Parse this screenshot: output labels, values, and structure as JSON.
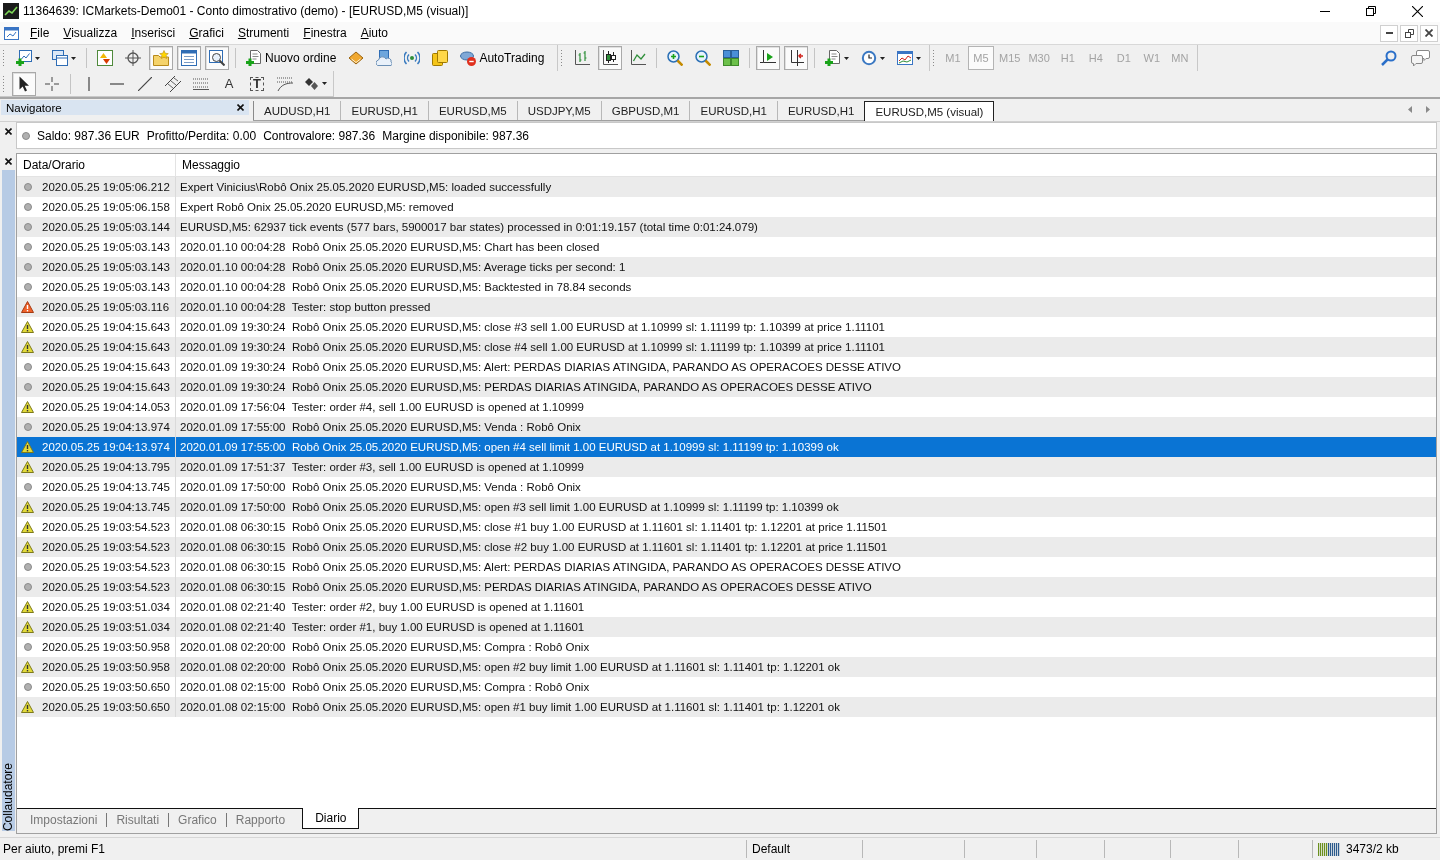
{
  "window": {
    "title": "11364639: ICMarkets-Demo01 - Conto dimostrativo (demo) - [EURUSD,M5 (visual)]"
  },
  "menu": [
    "File",
    "Visualizza",
    "Inserisci",
    "Grafici",
    "Strumenti",
    "Finestra",
    "Aiuto"
  ],
  "toolbar": [
    {
      "on": false,
      "dropdown": true
    },
    {
      "on": false,
      "dropdown": true
    },
    {
      "on": false,
      "dropdown": false
    },
    {
      "on": false,
      "dropdown": false
    },
    {
      "on": true,
      "dropdown": false
    },
    {
      "on": true,
      "dropdown": false
    },
    {
      "on": true,
      "dropdown": false
    },
    {
      "on": false,
      "dropdown": false,
      "label": "Nuovo ordine"
    },
    {
      "on": false,
      "dropdown": false
    },
    {
      "on": false,
      "dropdown": false
    },
    {
      "on": false,
      "dropdown": false
    },
    {
      "on": false,
      "dropdown": false
    },
    {
      "on": false,
      "dropdown": false,
      "label": "AutoTrading"
    },
    {
      "on": false,
      "dropdown": false
    },
    {
      "on": true,
      "dropdown": false
    },
    {
      "on": false,
      "dropdown": false
    },
    {
      "on": false,
      "dropdown": false
    },
    {
      "on": false,
      "dropdown": false
    },
    {
      "on": false,
      "dropdown": false
    },
    {
      "on": true,
      "dropdown": false
    },
    {
      "on": true,
      "dropdown": false
    },
    {
      "on": false,
      "dropdown": true
    },
    {
      "on": false,
      "dropdown": true
    },
    {
      "on": false,
      "dropdown": true
    }
  ],
  "timeframes": [
    {
      "label": "M1",
      "selected": false,
      "disabled": true
    },
    {
      "label": "M5",
      "selected": true,
      "disabled": true
    },
    {
      "label": "M15",
      "selected": false,
      "disabled": true
    },
    {
      "label": "M30",
      "selected": false,
      "disabled": true
    },
    {
      "label": "H1",
      "selected": false,
      "disabled": true
    },
    {
      "label": "H4",
      "selected": false,
      "disabled": true
    },
    {
      "label": "D1",
      "selected": false,
      "disabled": true
    },
    {
      "label": "W1",
      "selected": false,
      "disabled": true
    },
    {
      "label": "MN",
      "selected": false,
      "disabled": true
    }
  ],
  "drawing_tools": [
    {
      "on": true,
      "dropdown": false
    },
    {
      "on": false,
      "dropdown": false
    },
    {
      "on": false,
      "dropdown": false
    },
    {
      "on": false,
      "dropdown": false
    },
    {
      "on": false,
      "dropdown": false
    },
    {
      "on": false,
      "dropdown": false
    },
    {
      "on": false,
      "dropdown": false
    },
    {
      "on": false,
      "dropdown": false,
      "glyph": "A"
    },
    {
      "on": false,
      "dropdown": false,
      "glyph": "T"
    },
    {
      "on": false,
      "dropdown": false
    },
    {
      "on": false,
      "dropdown": true
    }
  ],
  "navigator": {
    "title": "Navigatore"
  },
  "chart_tabs": [
    {
      "label": "AUDUSD,H1",
      "selected": false
    },
    {
      "label": "EURUSD,H1",
      "selected": false
    },
    {
      "label": "EURUSD,M5",
      "selected": false
    },
    {
      "label": "USDJPY,M5",
      "selected": false
    },
    {
      "label": "GBPUSD,M1",
      "selected": false
    },
    {
      "label": "EURUSD,H1",
      "selected": false
    },
    {
      "label": "EURUSD,H1",
      "selected": false
    },
    {
      "label": "EURUSD,M5 (visual)",
      "selected": true
    }
  ],
  "account_bar": {
    "items": [
      "Saldo: 987.36 EUR",
      "Profitto/Perdita: 0.00",
      "Controvalore: 987.36",
      "Margine disponibile: 987.36"
    ]
  },
  "tester": {
    "title": "Collaudatore",
    "columns": [
      "Data/Orario",
      "Messaggio"
    ],
    "rows": [
      {
        "kind": "info",
        "selected": false,
        "time": "2020.05.25 19:05:06.212",
        "message": "Expert Vinicius\\Robô Onix 25.05.2020 EURUSD,M5: loaded successfully"
      },
      {
        "kind": "info",
        "selected": false,
        "time": "2020.05.25 19:05:06.158",
        "message": "Expert Robô Onix 25.05.2020 EURUSD,M5: removed"
      },
      {
        "kind": "info",
        "selected": false,
        "time": "2020.05.25 19:05:03.144",
        "message": "EURUSD,M5: 62937 tick events (577 bars, 5900017 bar states) processed in 0:01:19.157 (total time 0:01:24.079)"
      },
      {
        "kind": "info",
        "selected": false,
        "time": "2020.05.25 19:05:03.143",
        "message": "2020.01.10 00:04:28  Robô Onix 25.05.2020 EURUSD,M5: Chart has been closed"
      },
      {
        "kind": "info",
        "selected": false,
        "time": "2020.05.25 19:05:03.143",
        "message": "2020.01.10 00:04:28  Robô Onix 25.05.2020 EURUSD,M5: Average ticks per second: 1"
      },
      {
        "kind": "info",
        "selected": false,
        "time": "2020.05.25 19:05:03.143",
        "message": "2020.01.10 00:04:28  Robô Onix 25.05.2020 EURUSD,M5: Backtested in 78.84 seconds"
      },
      {
        "kind": "error",
        "selected": false,
        "time": "2020.05.25 19:05:03.116",
        "message": "2020.01.10 00:04:28  Tester: stop button pressed"
      },
      {
        "kind": "warning",
        "selected": false,
        "time": "2020.05.25 19:04:15.643",
        "message": "2020.01.09 19:30:24  Robô Onix 25.05.2020 EURUSD,M5: close #3 sell 1.00 EURUSD at 1.10999 sl: 1.11199 tp: 1.10399 at price 1.11101"
      },
      {
        "kind": "warning",
        "selected": false,
        "time": "2020.05.25 19:04:15.643",
        "message": "2020.01.09 19:30:24  Robô Onix 25.05.2020 EURUSD,M5: close #4 sell 1.00 EURUSD at 1.10999 sl: 1.11199 tp: 1.10399 at price 1.11101"
      },
      {
        "kind": "info",
        "selected": false,
        "time": "2020.05.25 19:04:15.643",
        "message": "2020.01.09 19:30:24  Robô Onix 25.05.2020 EURUSD,M5: Alert: PERDAS DIARIAS ATINGIDA, PARANDO AS OPERACOES DESSE ATIVO"
      },
      {
        "kind": "info",
        "selected": false,
        "time": "2020.05.25 19:04:15.643",
        "message": "2020.01.09 19:30:24  Robô Onix 25.05.2020 EURUSD,M5: PERDAS DIARIAS ATINGIDA, PARANDO AS OPERACOES DESSE ATIVO"
      },
      {
        "kind": "warning",
        "selected": false,
        "time": "2020.05.25 19:04:14.053",
        "message": "2020.01.09 17:56:04  Tester: order #4, sell 1.00 EURUSD is opened at 1.10999"
      },
      {
        "kind": "info",
        "selected": false,
        "time": "2020.05.25 19:04:13.974",
        "message": "2020.01.09 17:55:00  Robô Onix 25.05.2020 EURUSD,M5: Venda : Robô Onix"
      },
      {
        "kind": "warning",
        "selected": true,
        "time": "2020.05.25 19:04:13.974",
        "message": "2020.01.09 17:55:00  Robô Onix 25.05.2020 EURUSD,M5: open #4 sell limit 1.00 EURUSD at 1.10999 sl: 1.11199 tp: 1.10399 ok"
      },
      {
        "kind": "warning",
        "selected": false,
        "time": "2020.05.25 19:04:13.795",
        "message": "2020.01.09 17:51:37  Tester: order #3, sell 1.00 EURUSD is opened at 1.10999"
      },
      {
        "kind": "info",
        "selected": false,
        "time": "2020.05.25 19:04:13.745",
        "message": "2020.01.09 17:50:00  Robô Onix 25.05.2020 EURUSD,M5: Venda : Robô Onix"
      },
      {
        "kind": "warning",
        "selected": false,
        "time": "2020.05.25 19:04:13.745",
        "message": "2020.01.09 17:50:00  Robô Onix 25.05.2020 EURUSD,M5: open #3 sell limit 1.00 EURUSD at 1.10999 sl: 1.11199 tp: 1.10399 ok"
      },
      {
        "kind": "warning",
        "selected": false,
        "time": "2020.05.25 19:03:54.523",
        "message": "2020.01.08 06:30:15  Robô Onix 25.05.2020 EURUSD,M5: close #1 buy 1.00 EURUSD at 1.11601 sl: 1.11401 tp: 1.12201 at price 1.11501"
      },
      {
        "kind": "warning",
        "selected": false,
        "time": "2020.05.25 19:03:54.523",
        "message": "2020.01.08 06:30:15  Robô Onix 25.05.2020 EURUSD,M5: close #2 buy 1.00 EURUSD at 1.11601 sl: 1.11401 tp: 1.12201 at price 1.11501"
      },
      {
        "kind": "info",
        "selected": false,
        "time": "2020.05.25 19:03:54.523",
        "message": "2020.01.08 06:30:15  Robô Onix 25.05.2020 EURUSD,M5: Alert: PERDAS DIARIAS ATINGIDA, PARANDO AS OPERACOES DESSE ATIVO"
      },
      {
        "kind": "info",
        "selected": false,
        "time": "2020.05.25 19:03:54.523",
        "message": "2020.01.08 06:30:15  Robô Onix 25.05.2020 EURUSD,M5: PERDAS DIARIAS ATINGIDA, PARANDO AS OPERACOES DESSE ATIVO"
      },
      {
        "kind": "warning",
        "selected": false,
        "time": "2020.05.25 19:03:51.034",
        "message": "2020.01.08 02:21:40  Tester: order #2, buy 1.00 EURUSD is opened at 1.11601"
      },
      {
        "kind": "warning",
        "selected": false,
        "time": "2020.05.25 19:03:51.034",
        "message": "2020.01.08 02:21:40  Tester: order #1, buy 1.00 EURUSD is opened at 1.11601"
      },
      {
        "kind": "info",
        "selected": false,
        "time": "2020.05.25 19:03:50.958",
        "message": "2020.01.08 02:20:00  Robô Onix 25.05.2020 EURUSD,M5: Compra : Robô Onix"
      },
      {
        "kind": "warning",
        "selected": false,
        "time": "2020.05.25 19:03:50.958",
        "message": "2020.01.08 02:20:00  Robô Onix 25.05.2020 EURUSD,M5: open #2 buy limit 1.00 EURUSD at 1.11601 sl: 1.11401 tp: 1.12201 ok"
      },
      {
        "kind": "info",
        "selected": false,
        "time": "2020.05.25 19:03:50.650",
        "message": "2020.01.08 02:15:00  Robô Onix 25.05.2020 EURUSD,M5: Compra : Robô Onix"
      },
      {
        "kind": "warning",
        "selected": false,
        "time": "2020.05.25 19:03:50.650",
        "message": "2020.01.08 02:15:00  Robô Onix 25.05.2020 EURUSD,M5: open #1 buy limit 1.00 EURUSD at 1.11601 sl: 1.11401 tp: 1.12201 ok"
      }
    ],
    "tabs": [
      {
        "label": "Impostazioni",
        "selected": false
      },
      {
        "label": "Risultati",
        "selected": false
      },
      {
        "label": "Grafico",
        "selected": false
      },
      {
        "label": "Rapporto",
        "selected": false
      },
      {
        "label": "Diario",
        "selected": true
      }
    ]
  },
  "status_bar": {
    "help": "Per aiuto, premi F1",
    "profile": "Default",
    "traffic": "3473/2 kb"
  }
}
